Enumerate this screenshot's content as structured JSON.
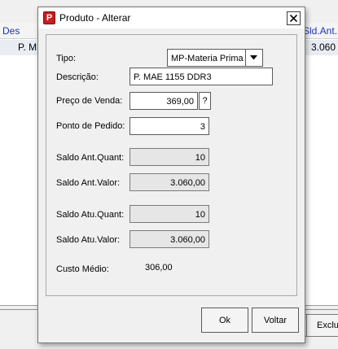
{
  "background": {
    "header": [
      "Des",
      "Sld.Ant."
    ],
    "row": [
      "P. M.",
      "3.060"
    ],
    "button_label": "Exclu"
  },
  "dialog": {
    "title": "Produto - Alterar",
    "close_glyph": "✕",
    "app_icon_letter": "P",
    "tipo": {
      "label": "Tipo:",
      "value": "MP-Materia Prima"
    },
    "descricao": {
      "label": "Descrição:",
      "value": "P. MAE 1155 DDR3"
    },
    "preco_venda": {
      "label": "Preço de Venda:",
      "value": "369,00",
      "help_label": "?"
    },
    "ponto_pedido": {
      "label": "Ponto de Pedido:",
      "value": "3"
    },
    "saldo_ant_quant": {
      "label": "Saldo Ant.Quant:",
      "value": "10"
    },
    "saldo_ant_valor": {
      "label": "Saldo Ant.Valor:",
      "value": "3.060,00"
    },
    "saldo_atu_quant": {
      "label": "Saldo Atu.Quant:",
      "value": "10"
    },
    "saldo_atu_valor": {
      "label": "Saldo Atu.Valor:",
      "value": "3.060,00"
    },
    "custo_medio": {
      "label": "Custo Médio:",
      "value": "306,00"
    },
    "ok_label": "Ok",
    "voltar_label": "Voltar"
  },
  "colors": {
    "header_text": "#1c33b0",
    "app_icon": "#c41e1e"
  }
}
